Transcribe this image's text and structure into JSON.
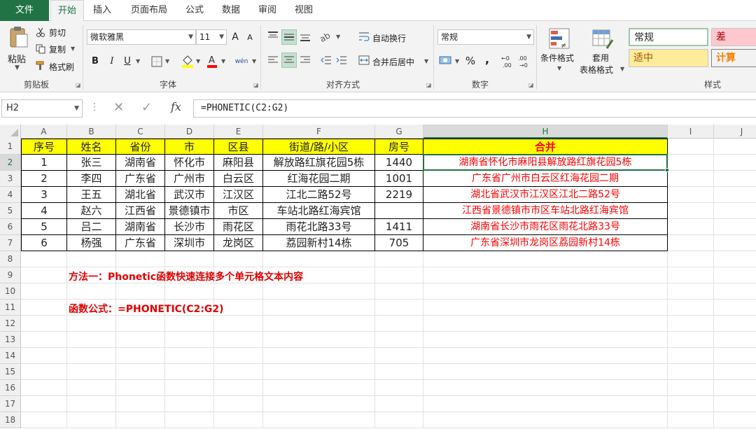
{
  "tabs": [
    {
      "label": "文件"
    },
    {
      "label": "开始"
    },
    {
      "label": "插入"
    },
    {
      "label": "页面布局"
    },
    {
      "label": "公式"
    },
    {
      "label": "数据"
    },
    {
      "label": "审阅"
    },
    {
      "label": "视图"
    }
  ],
  "ribbon": {
    "clipboard": {
      "paste": "粘贴",
      "cut": "剪切",
      "copy": "复制",
      "format_painter": "格式刷",
      "label": "剪贴板"
    },
    "font": {
      "name": "微软雅黑",
      "size": "11",
      "grow": "A",
      "shrink": "A",
      "bold": "B",
      "italic": "I",
      "underline": "U",
      "phonetic": "wén",
      "label": "字体"
    },
    "alignment": {
      "wrap_text": "自动换行",
      "merge_center": "合并后居中",
      "label": "对齐方式"
    },
    "number": {
      "format": "常规",
      "percent": "%",
      "comma": ",",
      "label": "数字"
    },
    "styles": {
      "conditional": "条件格式",
      "table_line1": "套用",
      "table_line2": "表格格式",
      "cells": [
        "常规",
        "差",
        "适中",
        "计算"
      ],
      "label": "样式"
    }
  },
  "formula_bar": {
    "name_box": "H2",
    "cancel": "✕",
    "enter": "✓",
    "fx": "fx",
    "formula": "=PHONETIC(C2:G2)"
  },
  "columns": [
    "A",
    "B",
    "C",
    "D",
    "E",
    "F",
    "G",
    "H",
    "I",
    "J"
  ],
  "rows": [
    "1",
    "2",
    "3",
    "4",
    "5",
    "6",
    "7",
    "8",
    "9",
    "10",
    "11",
    "12",
    "13",
    "14",
    "15",
    "16",
    "17",
    "18"
  ],
  "table": {
    "headers": [
      "序号",
      "姓名",
      "省份",
      "市",
      "区县",
      "街道/路/小区",
      "房号",
      "合并"
    ],
    "data": [
      [
        "1",
        "张三",
        "湖南省",
        "怀化市",
        "麻阳县",
        "解放路红旗花园5栋",
        "1440",
        "湖南省怀化市麻阳县解放路红旗花园5栋"
      ],
      [
        "2",
        "李四",
        "广东省",
        "广州市",
        "白云区",
        "红海花园二期",
        "1001",
        "广东省广州市白云区红海花园二期"
      ],
      [
        "3",
        "王五",
        "湖北省",
        "武汉市",
        "江汉区",
        "江北二路52号",
        "2219",
        "湖北省武汉市江汉区江北二路52号"
      ],
      [
        "4",
        "赵六",
        "江西省",
        "景德镇市",
        "市区",
        "车站北路红海宾馆",
        "",
        "江西省景德镇市市区车站北路红海宾馆"
      ],
      [
        "5",
        "吕二",
        "湖南省",
        "长沙市",
        "雨花区",
        "雨花北路33号",
        "1411",
        "湖南省长沙市雨花区雨花北路33号"
      ],
      [
        "6",
        "杨强",
        "广东省",
        "深圳市",
        "龙岗区",
        "荔园新村14栋",
        "705",
        "广东省深圳市龙岗区荔园新村14栋"
      ]
    ]
  },
  "notes": {
    "method": "方法一：Phonetic函数快速连接多个单元格文本内容",
    "formula": "函数公式：=PHONETIC(C2:G2)"
  },
  "colors": {
    "excel_green": "#217346",
    "header_fill": "#ffff00",
    "merged_text": "#ff0000",
    "bad_fill": "#ffc7ce",
    "neutral_fill": "#ffeb9c"
  }
}
